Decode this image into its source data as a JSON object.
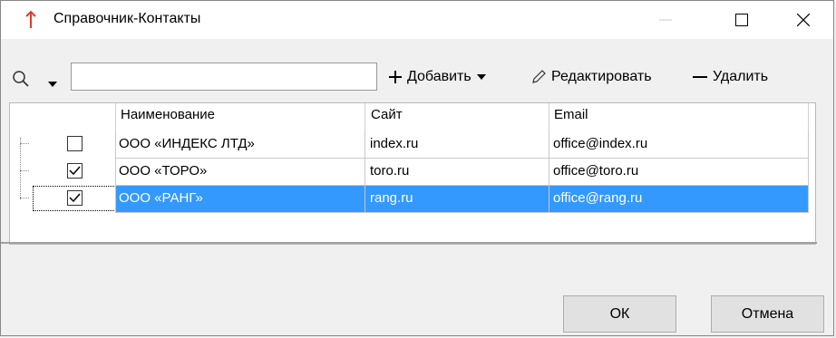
{
  "window": {
    "title": "Справочник-Контакты",
    "accent": "#e03c28",
    "selection_color": "#3399ff"
  },
  "titlebar_buttons": {
    "minimize_icon": "minimize-icon",
    "maximize_icon": "maximize-icon",
    "close_icon": "close-icon"
  },
  "toolbar": {
    "search_value": "",
    "add_label": "Добавить",
    "edit_label": "Редактировать",
    "delete_label": "Удалить"
  },
  "grid": {
    "columns": [
      "Наименование",
      "Сайт",
      "Email"
    ],
    "rows": [
      {
        "checked": false,
        "name": "ООО «ИНДЕКС ЛТД»",
        "site": "index.ru",
        "email": "office@index.ru",
        "selected": false
      },
      {
        "checked": true,
        "name": "ООО «ТОРО»",
        "site": "toro.ru",
        "email": "office@toro.ru",
        "selected": false
      },
      {
        "checked": true,
        "name": "ООО «РАНГ»",
        "site": "rang.ru",
        "email": "office@rang.ru",
        "selected": true
      }
    ]
  },
  "buttons": {
    "ok_label": "ОК",
    "cancel_label": "Отмена"
  }
}
